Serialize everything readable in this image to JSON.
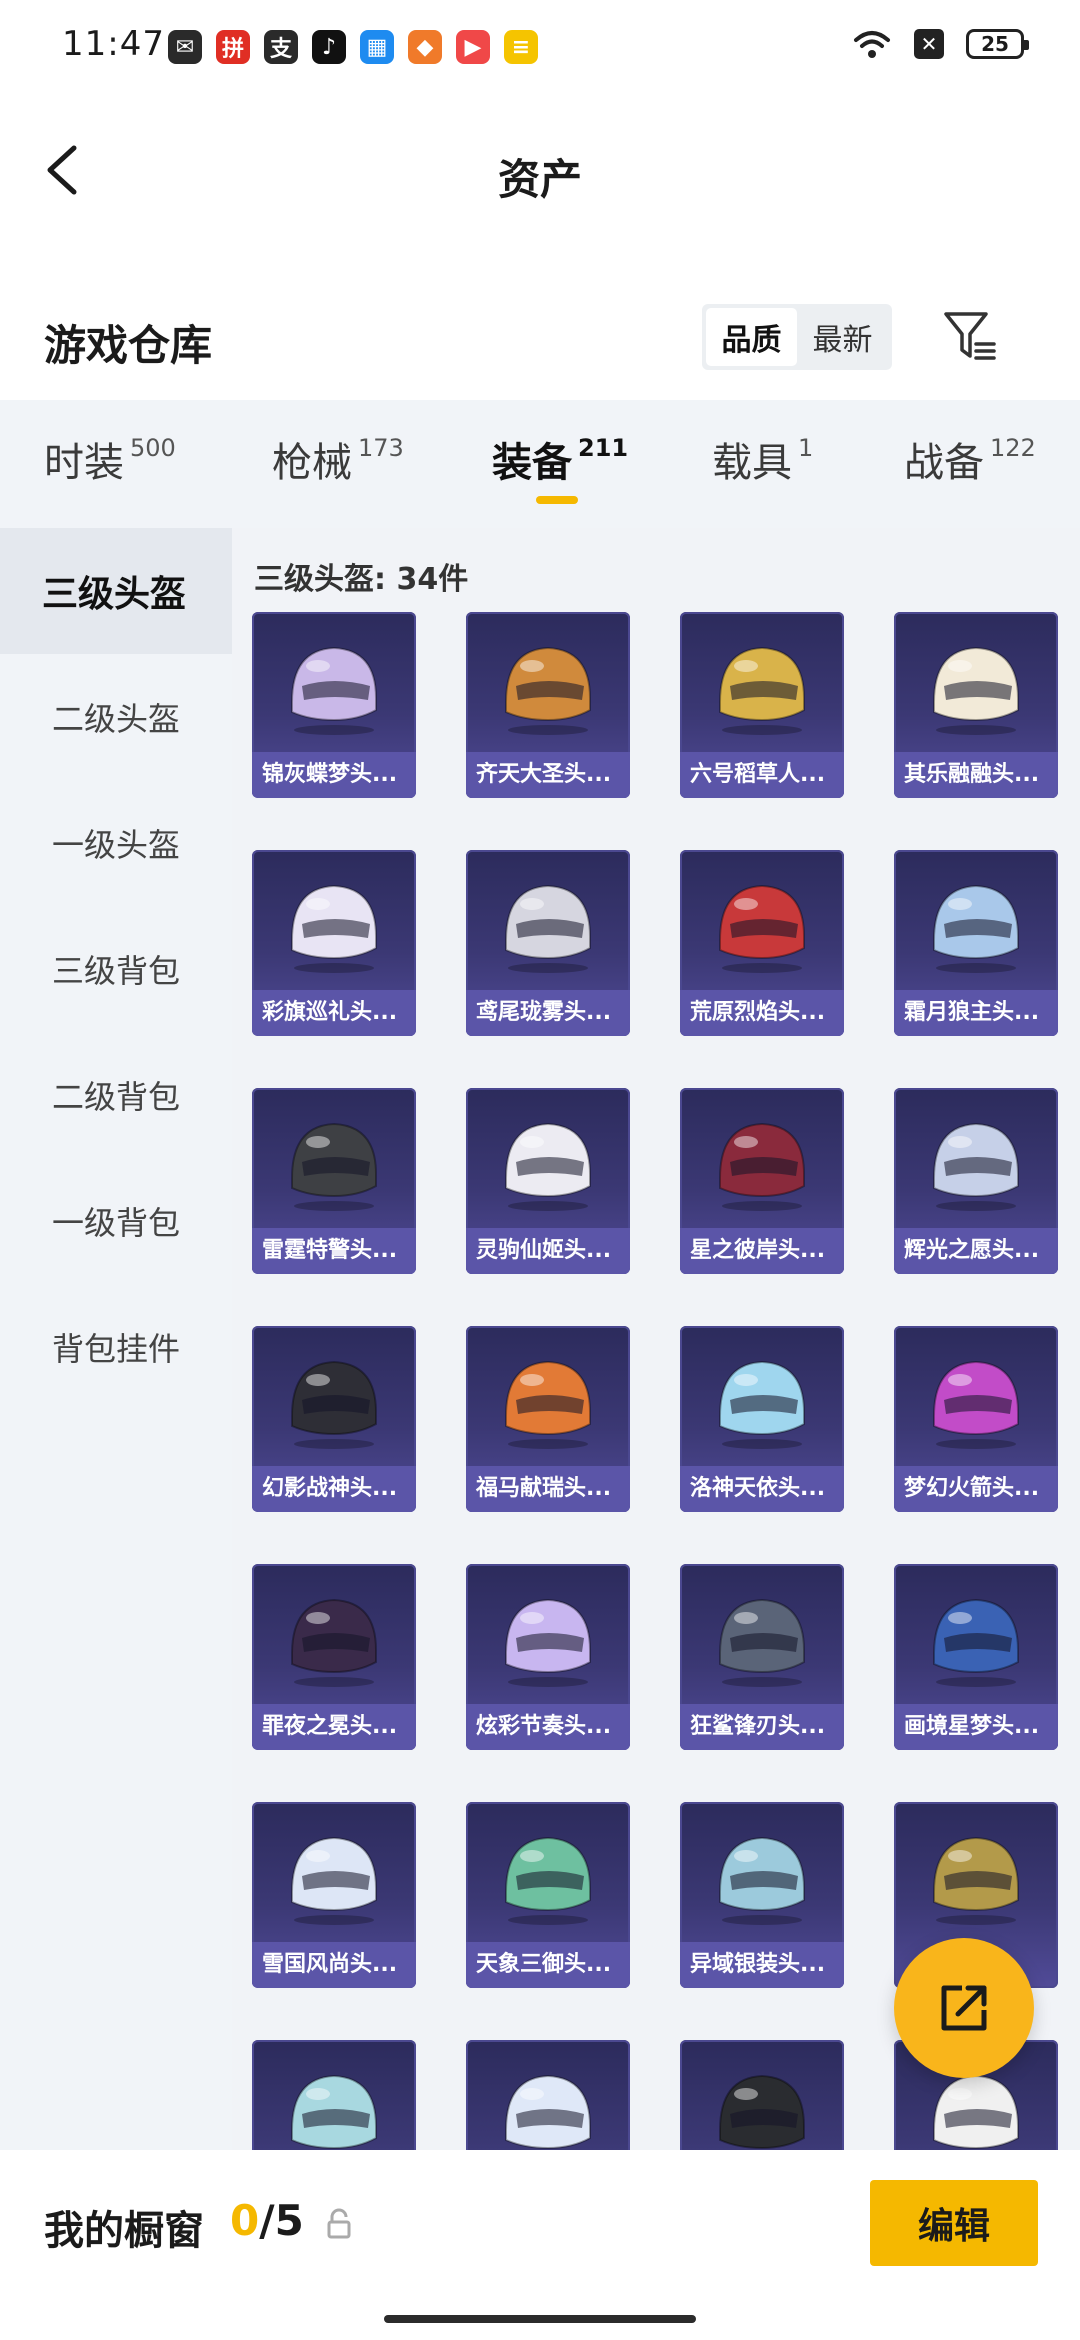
{
  "status_bar": {
    "time": "11:47",
    "battery": "25",
    "apps": [
      {
        "icon": "wechat-icon",
        "glyph": "✉",
        "color": "#2a2a2a"
      },
      {
        "icon": "pinduoduo-icon",
        "glyph": "拼",
        "color": "#e02e24"
      },
      {
        "icon": "alipay-icon",
        "glyph": "支",
        "color": "#2a2a2a"
      },
      {
        "icon": "douyin-icon",
        "glyph": "♪",
        "color": "#111111"
      },
      {
        "icon": "calendar-app-icon",
        "glyph": "▦",
        "color": "#1e8bf0"
      },
      {
        "icon": "game-app-icon",
        "glyph": "◆",
        "color": "#f07a2a"
      },
      {
        "icon": "video-app-icon",
        "glyph": "▶",
        "color": "#f04848"
      },
      {
        "icon": "notes-app-icon",
        "glyph": "≡",
        "color": "#f5c400"
      }
    ]
  },
  "header": {
    "title": "资产"
  },
  "section": {
    "title": "游戏仓库",
    "sort_options": [
      "品质",
      "最新"
    ],
    "active_sort": "品质"
  },
  "tabs": [
    {
      "label": "时装",
      "count": "500",
      "active": false
    },
    {
      "label": "枪械",
      "count": "173",
      "active": false
    },
    {
      "label": "装备",
      "count": "211",
      "active": true
    },
    {
      "label": "载具",
      "count": "1",
      "active": false
    },
    {
      "label": "战备",
      "count": "122",
      "active": false
    }
  ],
  "sidebar": {
    "items": [
      "三级头盔",
      "二级头盔",
      "一级头盔",
      "三级背包",
      "二级背包",
      "一级背包",
      "背包挂件"
    ],
    "active": "三级头盔"
  },
  "content": {
    "count_label": "三级头盔: 34件",
    "items": [
      {
        "label": "锦灰蝶梦头...",
        "color": "#c9b8e8"
      },
      {
        "label": "齐天大圣头...",
        "color": "#d08a3c"
      },
      {
        "label": "六号稻草人...",
        "color": "#d9b34a"
      },
      {
        "label": "其乐融融头...",
        "color": "#f2ead8"
      },
      {
        "label": "彩旗巡礼头...",
        "color": "#e8e4f4"
      },
      {
        "label": "鸢尾珑雾头...",
        "color": "#d6d6e0"
      },
      {
        "label": "荒原烈焰头...",
        "color": "#c8393a"
      },
      {
        "label": "霜月狼主头...",
        "color": "#a9c8ea"
      },
      {
        "label": "雷霆特警头...",
        "color": "#3e4044"
      },
      {
        "label": "灵驹仙姬头...",
        "color": "#ecebf2"
      },
      {
        "label": "星之彼岸头...",
        "color": "#8a2a3c"
      },
      {
        "label": "辉光之愿头...",
        "color": "#c6d0e8"
      },
      {
        "label": "幻影战神头...",
        "color": "#2e2e36"
      },
      {
        "label": "福马献瑞头...",
        "color": "#e27a36"
      },
      {
        "label": "洛神天依头...",
        "color": "#9fd6ee"
      },
      {
        "label": "梦幻火箭头...",
        "color": "#c24cc8"
      },
      {
        "label": "罪夜之冕头...",
        "color": "#3a2a4a"
      },
      {
        "label": "炫彩节奏头...",
        "color": "#c8b6f0"
      },
      {
        "label": "狂鲨锋刃头...",
        "color": "#5a6478"
      },
      {
        "label": "画境星梦头...",
        "color": "#3a62b4"
      },
      {
        "label": "雪国风尚头...",
        "color": "#dde6f6"
      },
      {
        "label": "天象三御头...",
        "color": "#6ec0a0"
      },
      {
        "label": "异域银装头...",
        "color": "#9ccadc"
      },
      {
        "label": "",
        "color": "#b39a4a"
      },
      {
        "label": "",
        "color": "#a8d8e0"
      },
      {
        "label": "",
        "color": "#dfe8f8"
      },
      {
        "label": "",
        "color": "#2a2c30"
      },
      {
        "label": "",
        "color": "#f0f0f0"
      }
    ]
  },
  "bottom": {
    "showcase_label": "我的橱窗",
    "current": "0",
    "max": "5",
    "edit_label": "编辑"
  }
}
